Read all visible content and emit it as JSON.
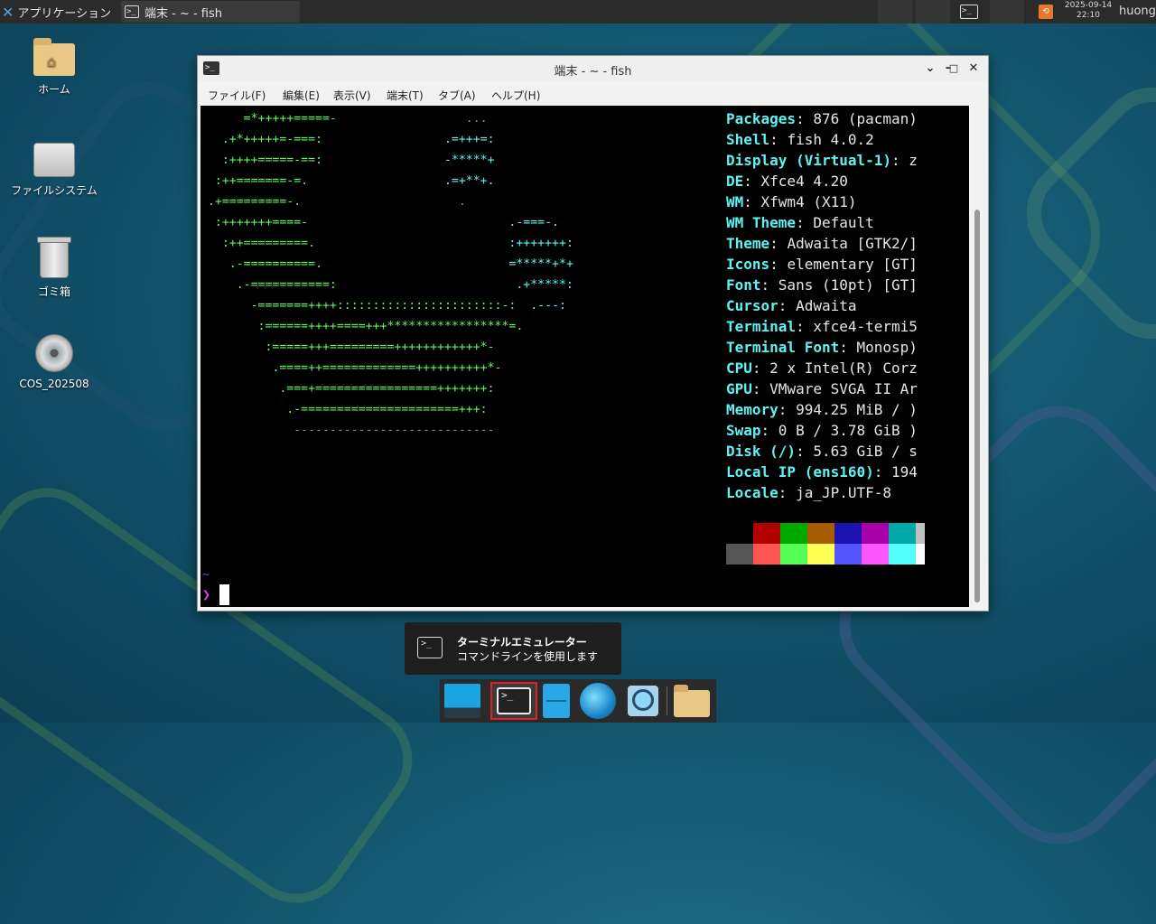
{
  "top_panel": {
    "apps_menu_label": "アプリケーション ",
    "task_title": "端末 - ~ - fish",
    "clock_date": "2025-09-14",
    "clock_time": "22:10",
    "user": "huong"
  },
  "desktop_icons": [
    {
      "label": "ホーム",
      "icon": "home-folder-icon"
    },
    {
      "label": "ファイルシステム",
      "icon": "harddisk-icon"
    },
    {
      "label": "ゴミ箱",
      "icon": "trash-icon"
    },
    {
      "label": "COS_202508",
      "icon": "optical-disc-icon"
    }
  ],
  "window": {
    "title": "端末 - ~ - fish",
    "menu": [
      "ファイル(F)",
      "編集(E)",
      "表示(V)",
      "端末(T)",
      "タブ(A)",
      "ヘルプ(H)"
    ]
  },
  "terminal": {
    "info": [
      {
        "key": "Packages",
        "value": ": 876 (pacman)"
      },
      {
        "key": "Shell",
        "value": ": fish 4.0.2"
      },
      {
        "key": "Display (Virtual-1)",
        "value": ": z"
      },
      {
        "key": "DE",
        "value": ": Xfce4 4.20"
      },
      {
        "key": "WM",
        "value": ": Xfwm4 (X11)"
      },
      {
        "key": "WM Theme",
        "value": ": Default"
      },
      {
        "key": "Theme",
        "value": ": Adwaita [GTK2/]"
      },
      {
        "key": "Icons",
        "value": ": elementary [GT]"
      },
      {
        "key": "Font",
        "value": ": Sans (10pt) [GT]"
      },
      {
        "key": "Cursor",
        "value": ": Adwaita"
      },
      {
        "key": "Terminal",
        "value": ": xfce4-termi5"
      },
      {
        "key": "Terminal Font",
        "value": ": Monosp)"
      },
      {
        "key": "CPU",
        "value": ": 2 x Intel(R) Corz"
      },
      {
        "key": "GPU",
        "value": ": VMware SVGA II Ar"
      },
      {
        "key": "Memory",
        "value": ": 994.25 MiB / )"
      },
      {
        "key": "Swap",
        "value": ": 0 B / 3.78 GiB )"
      },
      {
        "key": "Disk (/)",
        "value": ": 5.63 GiB / s"
      },
      {
        "key": "Local IP (ens160)",
        "value": ": 194"
      },
      {
        "key": "Locale",
        "value": ": ja_JP.UTF-8"
      }
    ],
    "palette_row1": [
      "#000000",
      "#b20000",
      "#00a800",
      "#a85c00",
      "#1a12b0",
      "#a800a8",
      "#00a8a8",
      "#bfbfbf"
    ],
    "palette_row2": [
      "#555555",
      "#ff5555",
      "#55ff55",
      "#ffff55",
      "#5555ff",
      "#ff55ff",
      "#55ffff",
      "#ffffff"
    ],
    "prompt_dir": "~",
    "prompt_symbol": "❯"
  },
  "tooltip": {
    "title": "ターミナルエミュレーター",
    "description": "コマンドラインを使用します"
  },
  "dock": [
    "show-desktop",
    "terminal",
    "file-manager",
    "web-browser",
    "app-finder",
    "home-folder"
  ]
}
